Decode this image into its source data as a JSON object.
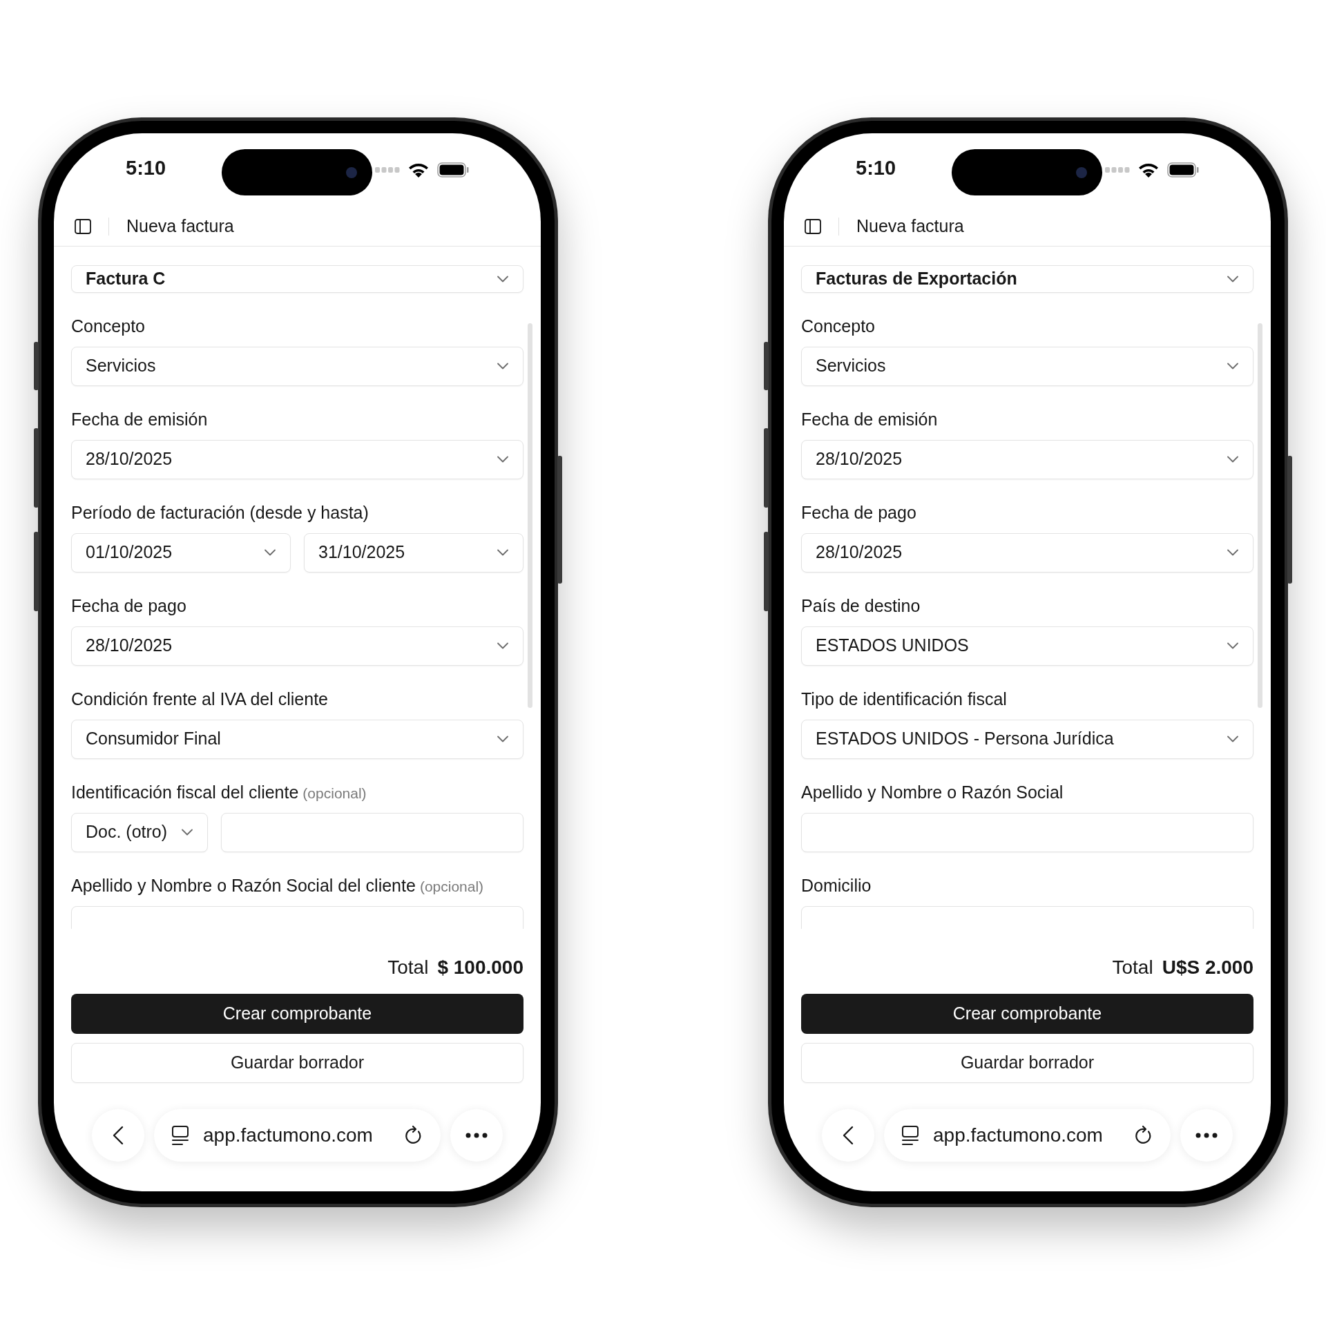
{
  "phones": [
    {
      "status_bar": {
        "time": "5:10"
      },
      "header": {
        "title": "Nueva factura"
      },
      "invoice_type": {
        "value": "Factura C"
      },
      "fields": [
        {
          "kind": "select",
          "label": "Concepto",
          "value": "Servicios"
        },
        {
          "kind": "select",
          "label": "Fecha de emisión",
          "value": "28/10/2025"
        },
        {
          "kind": "date_range",
          "label": "Período de facturación (desde y hasta)",
          "from": "01/10/2025",
          "to": "31/10/2025"
        },
        {
          "kind": "select",
          "label": "Fecha de pago",
          "value": "28/10/2025"
        },
        {
          "kind": "select",
          "label": "Condición frente al IVA del cliente",
          "value": "Consumidor Final"
        },
        {
          "kind": "id_pair",
          "label": "Identificación fiscal del cliente",
          "note": "(opcional)",
          "doc_type": "Doc. (otro)"
        },
        {
          "kind": "text",
          "label": "Apellido y Nombre o Razón Social del cliente",
          "note": "(opcional)"
        }
      ],
      "total": {
        "label": "Total",
        "amount": "$ 100.000"
      },
      "buttons": [
        {
          "kind": "primary",
          "label": "Crear comprobante"
        },
        {
          "kind": "secondary",
          "label": "Guardar borrador"
        }
      ],
      "browser": {
        "url": "app.factumono.com"
      }
    },
    {
      "status_bar": {
        "time": "5:10"
      },
      "header": {
        "title": "Nueva factura"
      },
      "invoice_type": {
        "value": "Facturas de Exportación"
      },
      "fields": [
        {
          "kind": "select",
          "label": "Concepto",
          "value": "Servicios"
        },
        {
          "kind": "select",
          "label": "Fecha de emisión",
          "value": "28/10/2025"
        },
        {
          "kind": "select",
          "label": "Fecha de pago",
          "value": "28/10/2025"
        },
        {
          "kind": "select",
          "label": "País de destino",
          "value": "ESTADOS UNIDOS"
        },
        {
          "kind": "select",
          "label": "Tipo de identificación fiscal",
          "value": "ESTADOS UNIDOS - Persona Jurídica"
        },
        {
          "kind": "text",
          "label": "Apellido y Nombre o Razón Social"
        },
        {
          "kind": "text",
          "label": "Domicilio"
        }
      ],
      "total": {
        "label": "Total",
        "amount": "U$S 2.000"
      },
      "buttons": [
        {
          "kind": "primary",
          "label": "Crear comprobante"
        },
        {
          "kind": "secondary",
          "label": "Guardar borrador"
        }
      ],
      "browser": {
        "url": "app.factumono.com"
      }
    }
  ]
}
